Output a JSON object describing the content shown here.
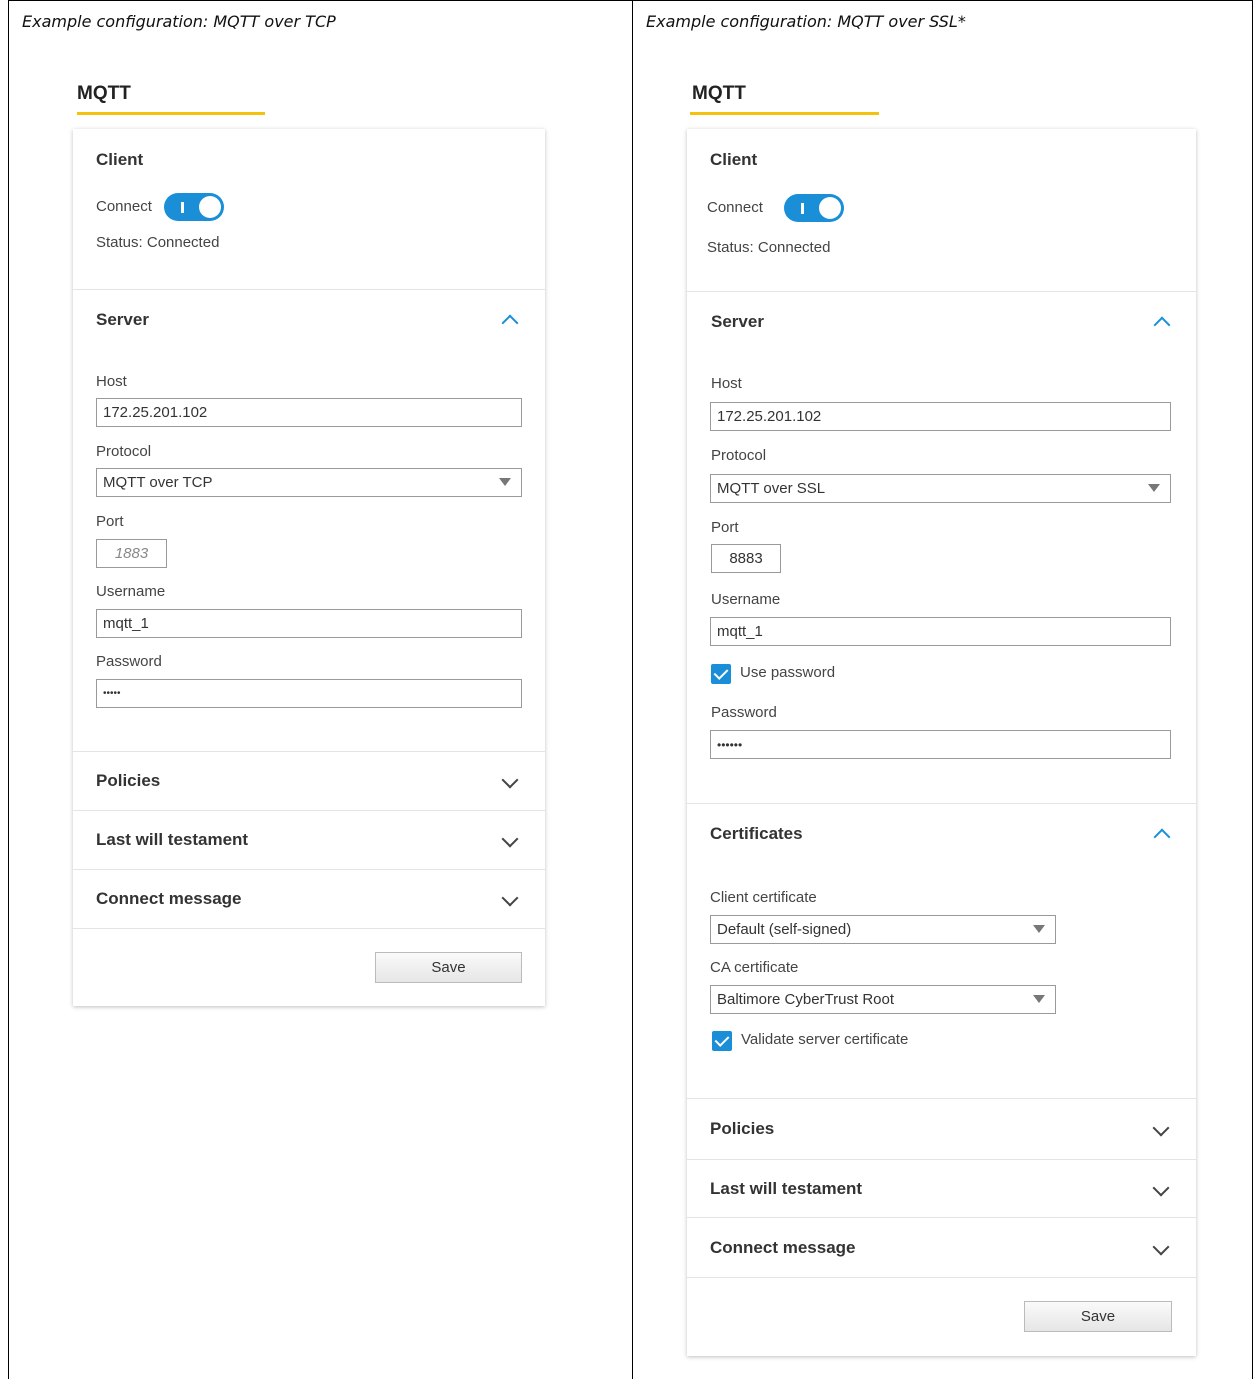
{
  "left": {
    "caption": "Example configuration: MQTT over TCP",
    "brand": "MQTT",
    "client": {
      "title": "Client",
      "connect_label": "Connect",
      "toggle_on": true,
      "status": "Status: Connected"
    },
    "server": {
      "title": "Server",
      "host_label": "Host",
      "host_value": "172.25.201.102",
      "protocol_label": "Protocol",
      "protocol_value": "MQTT over TCP",
      "port_label": "Port",
      "port_placeholder": "1883",
      "username_label": "Username",
      "username_value": "mqtt_1",
      "password_label": "Password",
      "password_value": "•••••"
    },
    "collapsed_sections": [
      "Policies",
      "Last will testament",
      "Connect message"
    ],
    "save_label": "Save"
  },
  "right": {
    "caption": "Example configuration: MQTT over SSL*",
    "brand": "MQTT",
    "client": {
      "title": "Client",
      "connect_label": "Connect",
      "toggle_on": true,
      "status": "Status: Connected"
    },
    "server": {
      "title": "Server",
      "host_label": "Host",
      "host_value": "172.25.201.102",
      "protocol_label": "Protocol",
      "protocol_value": "MQTT over SSL",
      "port_label": "Port",
      "port_value": "8883",
      "username_label": "Username",
      "username_value": "mqtt_1",
      "use_password_label": "Use password",
      "use_password_checked": true,
      "password_label": "Password",
      "password_value": "••••••"
    },
    "certificates": {
      "title": "Certificates",
      "client_cert_label": "Client certificate",
      "client_cert_value": "Default (self-signed)",
      "ca_cert_label": "CA certificate",
      "ca_cert_value": "Baltimore CyberTrust Root",
      "validate_label": "Validate server certificate",
      "validate_checked": true
    },
    "collapsed_sections": [
      "Policies",
      "Last will testament",
      "Connect message"
    ],
    "save_label": "Save"
  },
  "colors": {
    "accent": "#1a8fd8",
    "brand_underline": "#f4c20d"
  }
}
